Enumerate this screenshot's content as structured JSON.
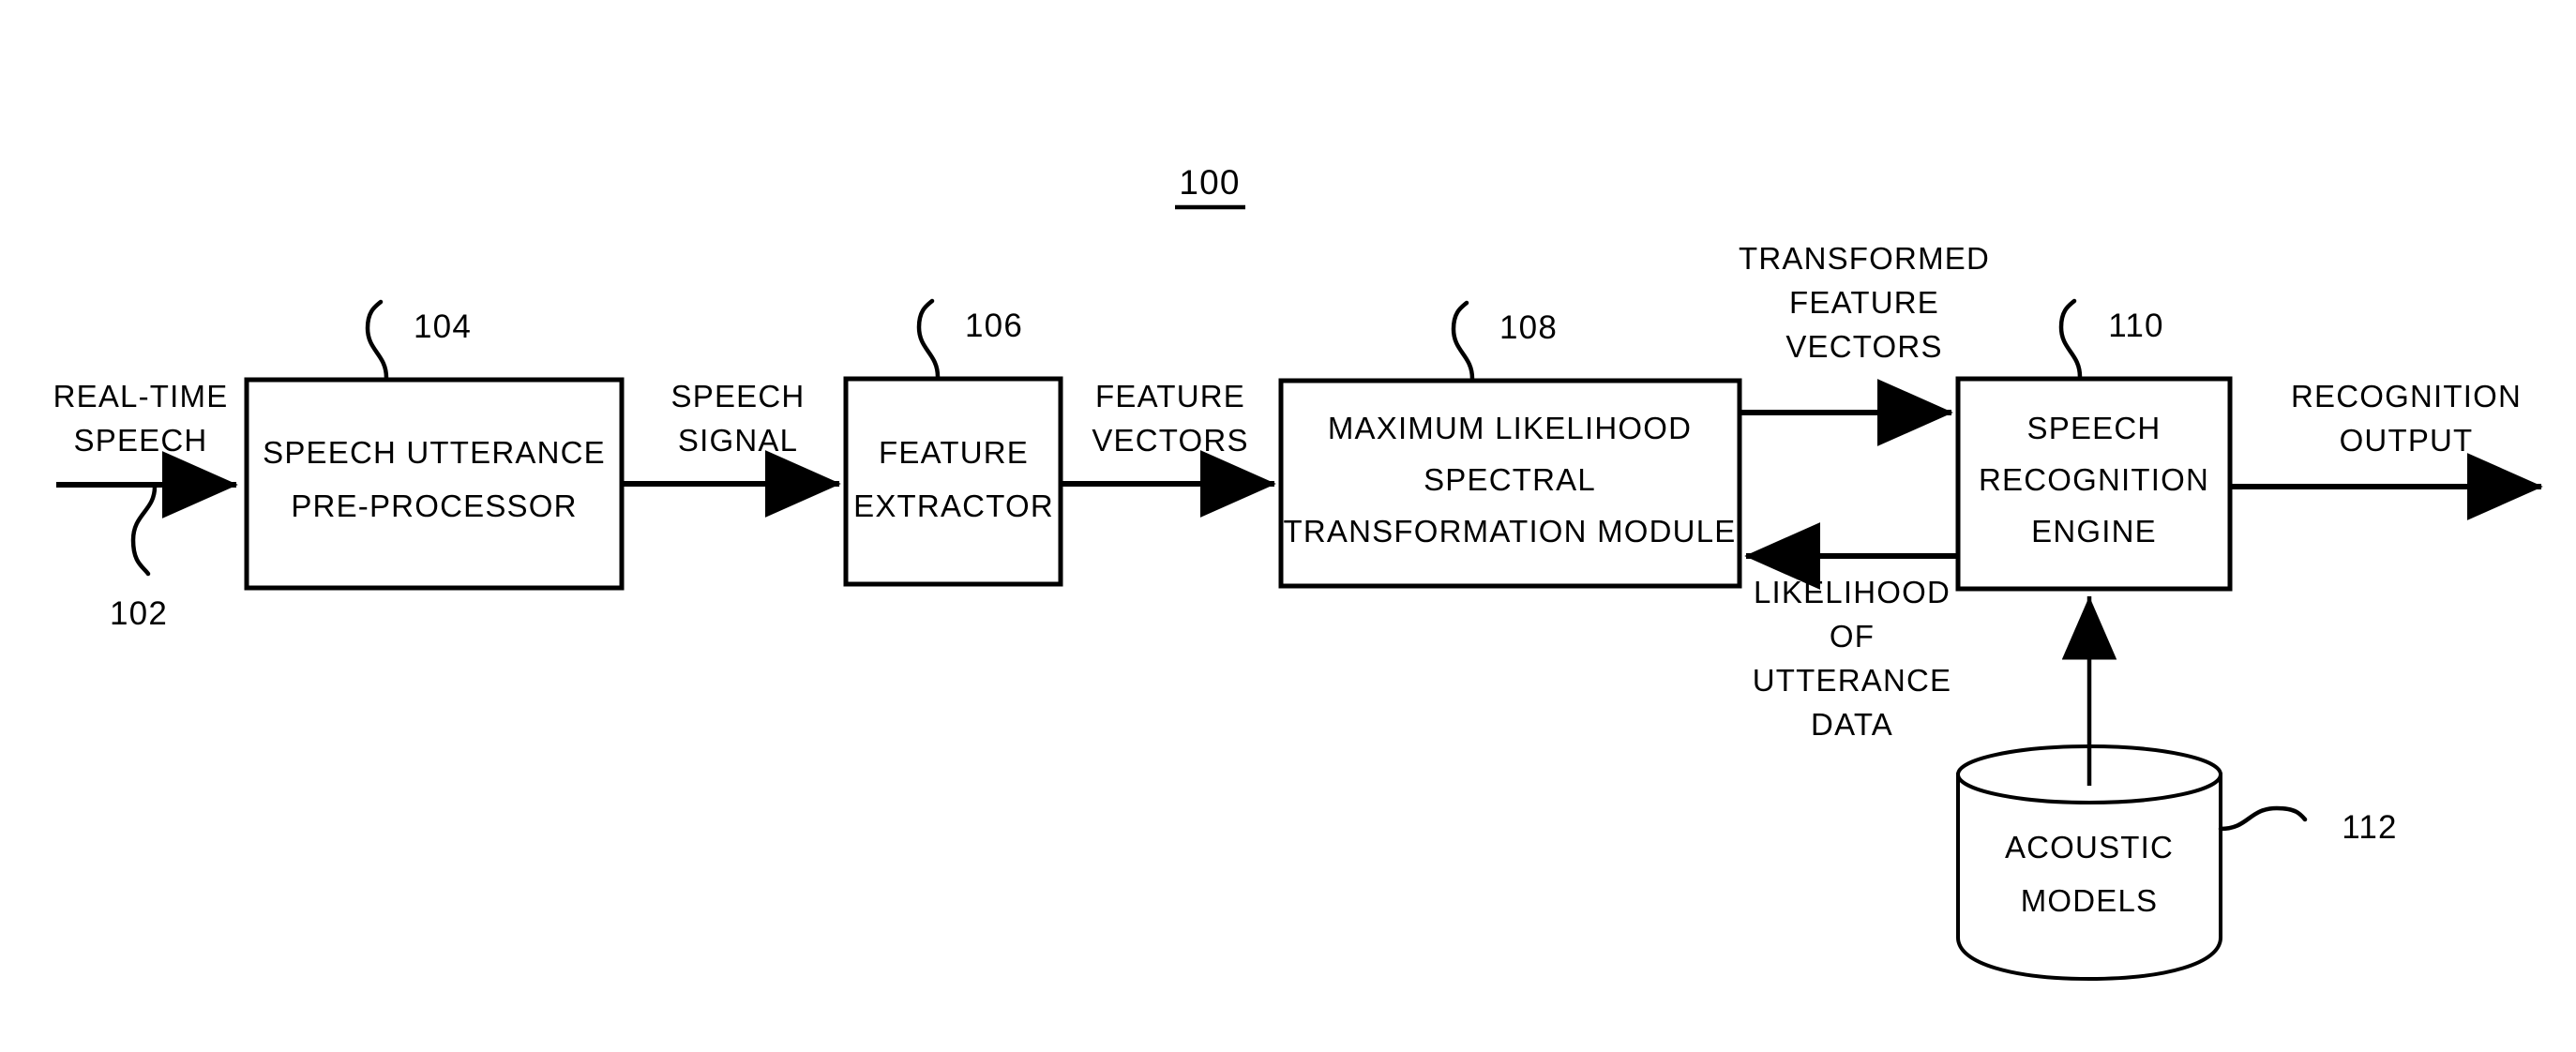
{
  "figure": {
    "title_number": "100",
    "background_color": "#ffffff",
    "line_color": "#000000"
  },
  "blocks": [
    {
      "id": "speech-utterance-pre-processor",
      "ref": "104",
      "lines": [
        "SPEECH  UTTERANCE",
        "PRE-PROCESSOR"
      ],
      "shape": "rectangle"
    },
    {
      "id": "feature-extractor",
      "ref": "106",
      "lines": [
        "FEATURE",
        "EXTRACTOR"
      ],
      "shape": "rectangle"
    },
    {
      "id": "maximum-likelihood-spectral-transformation-module",
      "ref": "108",
      "lines": [
        "MAXIMUM  LIKELIHOOD",
        "SPECTRAL",
        "TRANSFORMATION  MODULE"
      ],
      "shape": "rectangle"
    },
    {
      "id": "speech-recognition-engine",
      "ref": "110",
      "lines": [
        "SPEECH",
        "RECOGNITION",
        "ENGINE"
      ],
      "shape": "rectangle"
    },
    {
      "id": "acoustic-models",
      "ref": "112",
      "lines": [
        "ACOUSTIC",
        "MODELS"
      ],
      "shape": "cylinder"
    }
  ],
  "flow_labels": {
    "input_signal": [
      "REAL-TIME",
      "SPEECH"
    ],
    "input_ref": "102",
    "speech_signal": [
      "SPEECH",
      "SIGNAL"
    ],
    "feature_vectors": [
      "FEATURE",
      "VECTORS"
    ],
    "transformed_feature_vectors": [
      "TRANSFORMED",
      "FEATURE",
      "VECTORS"
    ],
    "likelihood_of_utterance_data": [
      "LIKELIHOOD",
      "OF",
      "UTTERANCE",
      "DATA"
    ],
    "recognition_output": [
      "RECOGNITION",
      "OUTPUT"
    ]
  },
  "text": {
    "title": "100",
    "ref_102": "102",
    "ref_104": "104",
    "ref_106": "106",
    "ref_108": "108",
    "ref_110": "110",
    "ref_112": "112",
    "real_time": "REAL-TIME",
    "speech": "SPEECH",
    "speech_2": "SPEECH",
    "signal": "SIGNAL",
    "feature": "FEATURE",
    "vectors": "VECTORS",
    "transformed": "TRANSFORMED",
    "feature_2": "FEATURE",
    "vectors_2": "VECTORS",
    "likelihood": "LIKELIHOOD",
    "of": "OF",
    "utterance": "UTTERANCE",
    "data": "DATA",
    "recognition": "RECOGNITION",
    "output": "OUTPUT",
    "b1l1": "SPEECH  UTTERANCE",
    "b1l2": "PRE-PROCESSOR",
    "b2l1": "FEATURE",
    "b2l2": "EXTRACTOR",
    "b3l1": "MAXIMUM  LIKELIHOOD",
    "b3l2": "SPECTRAL",
    "b3l3": "TRANSFORMATION  MODULE",
    "b4l1": "SPEECH",
    "b4l2": "RECOGNITION",
    "b4l3": "ENGINE",
    "b5l1": "ACOUSTIC",
    "b5l2": "MODELS"
  }
}
